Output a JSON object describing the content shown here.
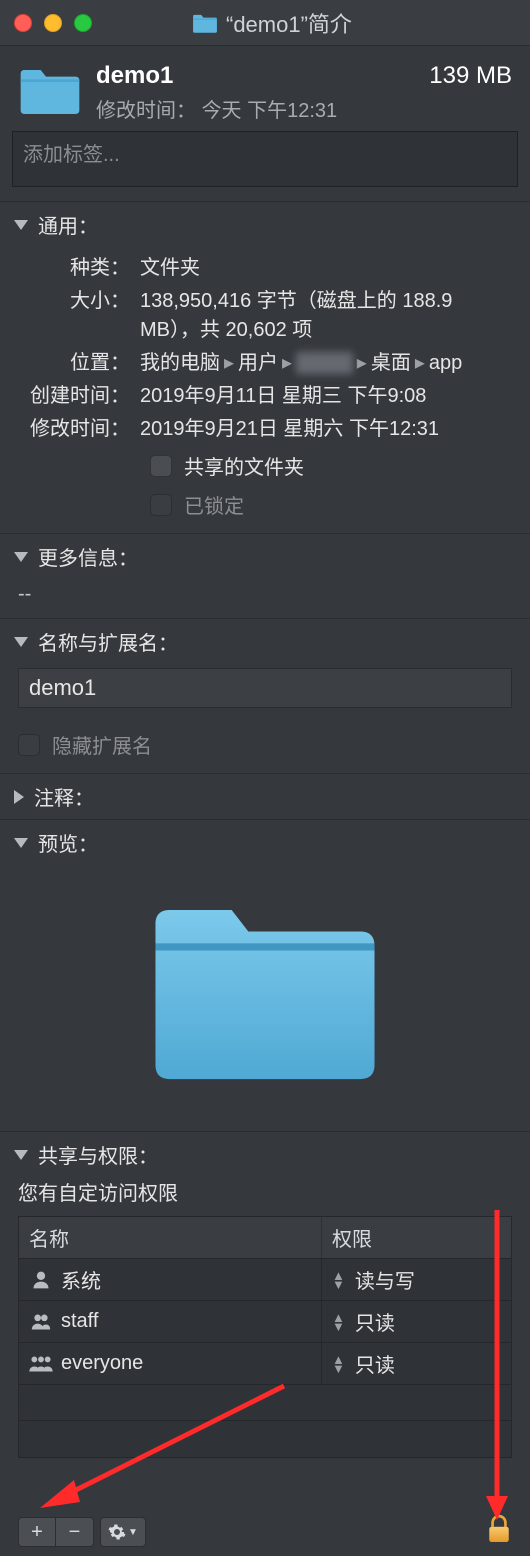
{
  "window": {
    "title": "“demo1”简介"
  },
  "header": {
    "name": "demo1",
    "size": "139 MB",
    "modified_label": "修改时间：",
    "modified_value": "今天 下午12:31"
  },
  "tags": {
    "placeholder": "添加标签..."
  },
  "sections": {
    "general": {
      "title": "通用：",
      "kind_label": "种类：",
      "kind_value": "文件夹",
      "size_label": "大小：",
      "size_value": "138,950,416 字节（磁盘上的 188.9 MB），共 20,602 项",
      "where_label": "位置：",
      "where_parts": [
        "我的电脑",
        "用户",
        "████",
        "桌面",
        "app"
      ],
      "created_label": "创建时间：",
      "created_value": "2019年9月11日 星期三 下午9:08",
      "modified_label": "修改时间：",
      "modified_value": "2019年9月21日 星期六 下午12:31",
      "shared_folder_label": "共享的文件夹",
      "locked_label": "已锁定"
    },
    "moreinfo": {
      "title": "更多信息：",
      "content": "--"
    },
    "nameext": {
      "title": "名称与扩展名：",
      "value": "demo1",
      "hide_ext_label": "隐藏扩展名"
    },
    "comments": {
      "title": "注释："
    },
    "preview": {
      "title": "预览："
    },
    "sharing": {
      "title": "共享与权限：",
      "note": "您有自定访问权限",
      "col_name": "名称",
      "col_priv": "权限",
      "rows": [
        {
          "name": "系统",
          "priv": "读与写",
          "icon": "person"
        },
        {
          "name": "staff",
          "priv": "只读",
          "icon": "group"
        },
        {
          "name": "everyone",
          "priv": "只读",
          "icon": "group3"
        }
      ]
    }
  },
  "toolbar": {
    "add": "+",
    "remove": "−",
    "gear": "gear"
  }
}
